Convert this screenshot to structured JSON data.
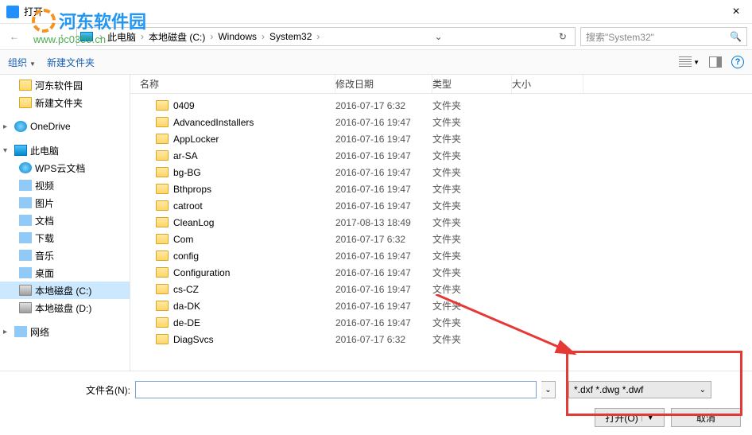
{
  "window": {
    "title": "打开"
  },
  "watermark": {
    "brand": "河东软件园",
    "url": "www.pc0359.cn"
  },
  "breadcrumb": {
    "segs": [
      "此电脑",
      "本地磁盘 (C:)",
      "Windows",
      "System32"
    ],
    "search_placeholder": "搜索\"System32\""
  },
  "toolbar": {
    "organize": "组织",
    "newfolder": "新建文件夹"
  },
  "sidebar": [
    {
      "label": "河东软件园",
      "icon": "folder",
      "level": 2
    },
    {
      "label": "新建文件夹",
      "icon": "folder",
      "level": 2
    },
    {
      "spacer": true
    },
    {
      "label": "OneDrive",
      "icon": "cloud",
      "level": 1,
      "caret": "▸"
    },
    {
      "spacer": true
    },
    {
      "label": "此电脑",
      "icon": "pc",
      "level": 1,
      "caret": "▾"
    },
    {
      "label": "WPS云文档",
      "icon": "cloud",
      "level": 2
    },
    {
      "label": "视频",
      "icon": "generic",
      "level": 2
    },
    {
      "label": "图片",
      "icon": "generic",
      "level": 2
    },
    {
      "label": "文档",
      "icon": "generic",
      "level": 2
    },
    {
      "label": "下载",
      "icon": "generic",
      "level": 2
    },
    {
      "label": "音乐",
      "icon": "generic",
      "level": 2
    },
    {
      "label": "桌面",
      "icon": "generic",
      "level": 2
    },
    {
      "label": "本地磁盘 (C:)",
      "icon": "drive",
      "level": 2,
      "sel": true
    },
    {
      "label": "本地磁盘 (D:)",
      "icon": "drive",
      "level": 2
    },
    {
      "spacer": true
    },
    {
      "label": "网络",
      "icon": "generic",
      "level": 1,
      "caret": "▸"
    }
  ],
  "columns": {
    "name": "名称",
    "date": "修改日期",
    "type": "类型",
    "size": "大小"
  },
  "files": [
    {
      "name": "0409",
      "date": "2016-07-17 6:32",
      "type": "文件夹"
    },
    {
      "name": "AdvancedInstallers",
      "date": "2016-07-16 19:47",
      "type": "文件夹"
    },
    {
      "name": "AppLocker",
      "date": "2016-07-16 19:47",
      "type": "文件夹"
    },
    {
      "name": "ar-SA",
      "date": "2016-07-16 19:47",
      "type": "文件夹"
    },
    {
      "name": "bg-BG",
      "date": "2016-07-16 19:47",
      "type": "文件夹"
    },
    {
      "name": "Bthprops",
      "date": "2016-07-16 19:47",
      "type": "文件夹"
    },
    {
      "name": "catroot",
      "date": "2016-07-16 19:47",
      "type": "文件夹"
    },
    {
      "name": "CleanLog",
      "date": "2017-08-13 18:49",
      "type": "文件夹"
    },
    {
      "name": "Com",
      "date": "2016-07-17 6:32",
      "type": "文件夹"
    },
    {
      "name": "config",
      "date": "2016-07-16 19:47",
      "type": "文件夹"
    },
    {
      "name": "Configuration",
      "date": "2016-07-16 19:47",
      "type": "文件夹"
    },
    {
      "name": "cs-CZ",
      "date": "2016-07-16 19:47",
      "type": "文件夹"
    },
    {
      "name": "da-DK",
      "date": "2016-07-16 19:47",
      "type": "文件夹"
    },
    {
      "name": "de-DE",
      "date": "2016-07-16 19:47",
      "type": "文件夹"
    },
    {
      "name": "DiagSvcs",
      "date": "2016-07-17 6:32",
      "type": "文件夹"
    }
  ],
  "bottom": {
    "filename_label": "文件名(N):",
    "filename_value": "",
    "filetype": "*.dxf *.dwg *.dwf",
    "open": "打开(O)",
    "cancel": "取消"
  }
}
